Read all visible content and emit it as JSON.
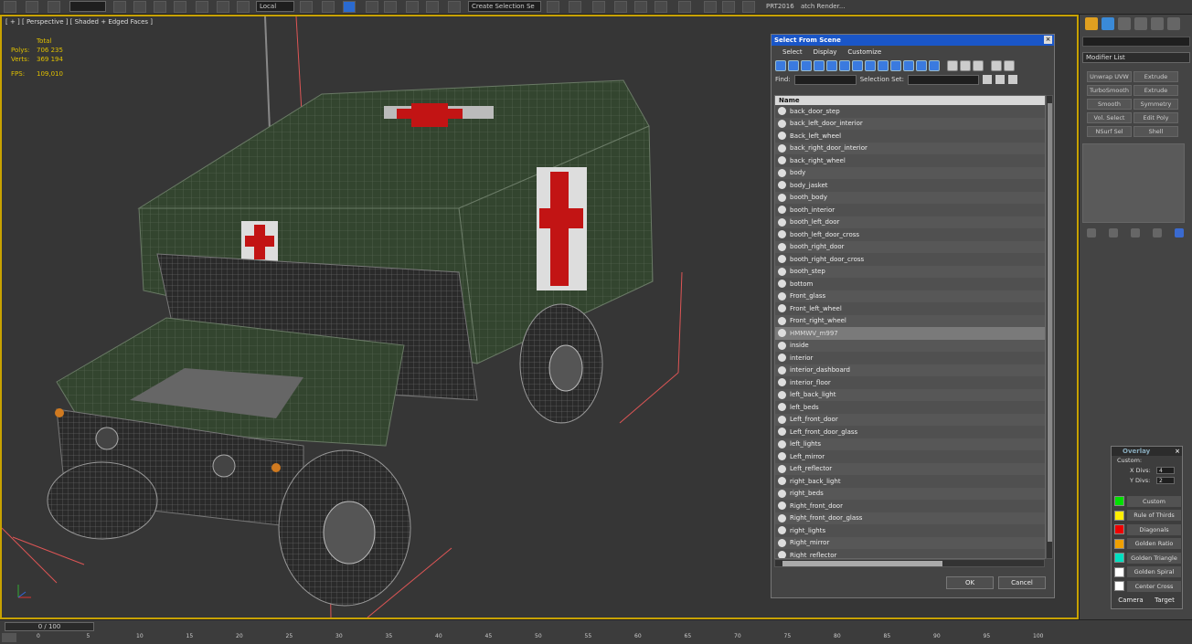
{
  "toolbar": {
    "create_selection_set": "Create Selection Se",
    "prt_label": "PRT2016",
    "batch_render": "atch Render...",
    "ref_coord": "Local"
  },
  "viewport": {
    "label": "[ + ] [ Perspective ] [ Shaded + Edged Faces ]",
    "stats": {
      "total_label": "Total",
      "polys_label": "Polys:",
      "polys_value": "706 235",
      "verts_label": "Verts:",
      "verts_value": "369 194",
      "fps_label": "FPS:",
      "fps_value": "109,010"
    }
  },
  "dialog": {
    "title": "Select From Scene",
    "menu": [
      "Select",
      "Display",
      "Customize"
    ],
    "find_label": "Find:",
    "selection_set_label": "Selection Set:",
    "column_header": "Name",
    "items": [
      "back_door_step",
      "back_left_door_interior",
      "Back_left_wheel",
      "back_right_door_interior",
      "back_right_wheel",
      "body",
      "body_jasket",
      "booth_body",
      "booth_interior",
      "booth_left_door",
      "booth_left_door_cross",
      "booth_right_door",
      "booth_right_door_cross",
      "booth_step",
      "bottom",
      "Front_glass",
      "Front_left_wheel",
      "Front_right_wheel",
      "HMMWV_m997",
      "inside",
      "interior",
      "interior_dashboard",
      "interior_floor",
      "left_back_light",
      "left_beds",
      "Left_front_door",
      "Left_front_door_glass",
      "left_lights",
      "Left_mirror",
      "Left_reflector",
      "right_back_light",
      "right_beds",
      "Right_front_door",
      "Right_front_door_glass",
      "right_lights",
      "Right_mirror",
      "Right_reflector"
    ],
    "selected_item": "HMMWV_m997",
    "ok_label": "OK",
    "cancel_label": "Cancel"
  },
  "command_panel": {
    "modifier_list": "Modifier List",
    "buttons": [
      "Unwrap UVW",
      "Extrude",
      "TurboSmooth",
      "Extrude",
      "Smooth",
      "Symmetry",
      "Vol. Select",
      "Edit Poly",
      "NSurf Sel",
      "Shell"
    ]
  },
  "overlay": {
    "title": "Overlay",
    "custom_label": "Custom:",
    "xdivs_label": "X Divs:",
    "xdivs_value": "4",
    "ydivs_label": "Y Divs:",
    "ydivs_value": "2",
    "items": [
      {
        "label": "Custom",
        "color": "#00e000"
      },
      {
        "label": "Rule of Thirds",
        "color": "#ffee00"
      },
      {
        "label": "Diagonals",
        "color": "#ee0000"
      },
      {
        "label": "Golden Ratio",
        "color": "#f0a000"
      },
      {
        "label": "Golden Triangle",
        "color": "#00e0c0"
      },
      {
        "label": "Golden Spiral",
        "color": "#ffffff"
      },
      {
        "label": "Center Cross",
        "color": "#ffffff"
      }
    ],
    "camera_label": "Camera",
    "target_label": "Target"
  },
  "timeline": {
    "slider_label": "0 / 100",
    "ticks": [
      "0",
      "5",
      "10",
      "15",
      "20",
      "25",
      "30",
      "35",
      "40",
      "45",
      "50",
      "55",
      "60",
      "65",
      "70",
      "75",
      "80",
      "85",
      "90",
      "95",
      "100"
    ]
  },
  "colors": {
    "viewport_border": "#c8a200",
    "title_bar": "#1a56c8",
    "stats": "#e0c000",
    "vehicle_green": "#3a4a3a",
    "red_cross": "#cc1111"
  }
}
